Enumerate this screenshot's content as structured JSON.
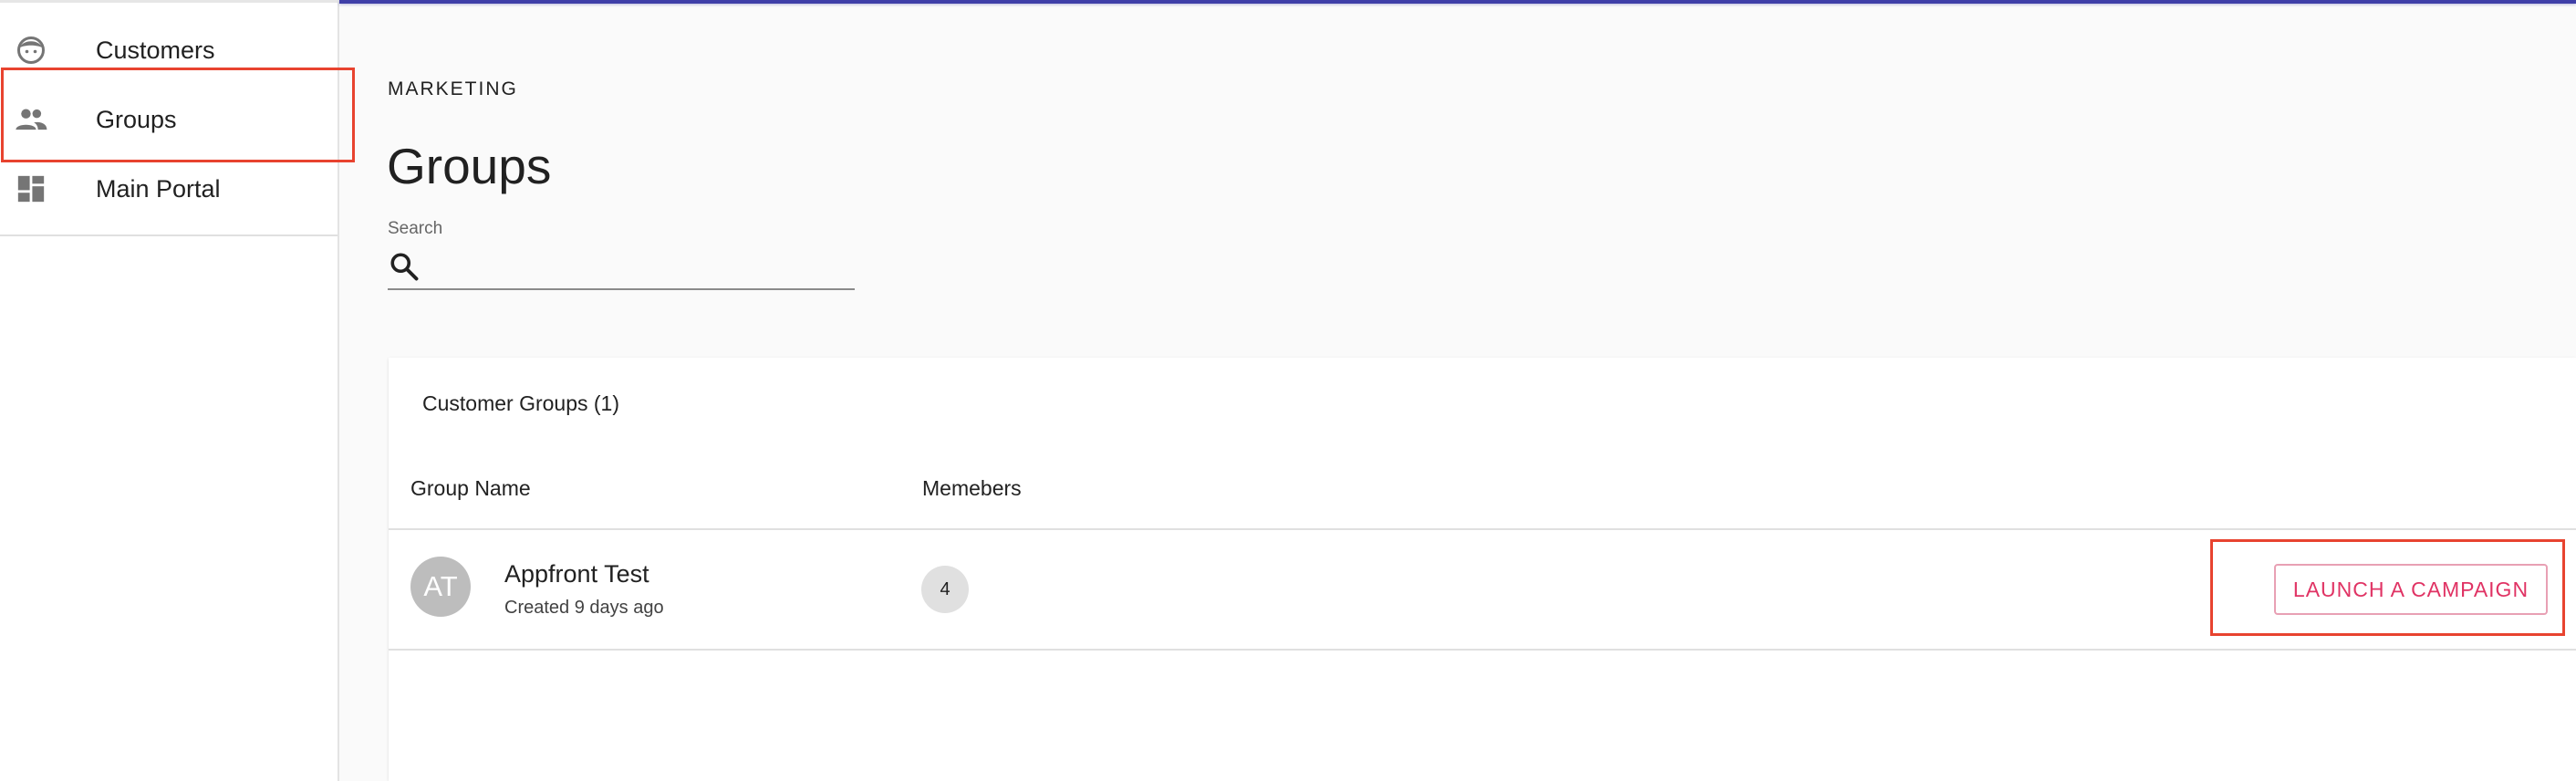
{
  "sidebar": {
    "items": [
      {
        "label": "Customers",
        "icon": "face-icon"
      },
      {
        "label": "Groups",
        "icon": "people-icon"
      },
      {
        "label": "Main Portal",
        "icon": "dashboard-icon"
      }
    ]
  },
  "main": {
    "eyebrow": "MARKETING",
    "title": "Groups",
    "search": {
      "label": "Search",
      "value": "",
      "placeholder": ""
    }
  },
  "card": {
    "title": "Customer Groups (1)",
    "columns": [
      "Group Name",
      "Memebers"
    ],
    "rows": [
      {
        "avatar_initials": "AT",
        "name": "Appfront Test",
        "created": "Created 9 days ago",
        "members": "4",
        "action_label": "LAUNCH A CAMPAIGN"
      }
    ]
  },
  "colors": {
    "accent_bar": "#3f3fa8",
    "highlight": "#e8432f",
    "action_text": "#e03364"
  }
}
